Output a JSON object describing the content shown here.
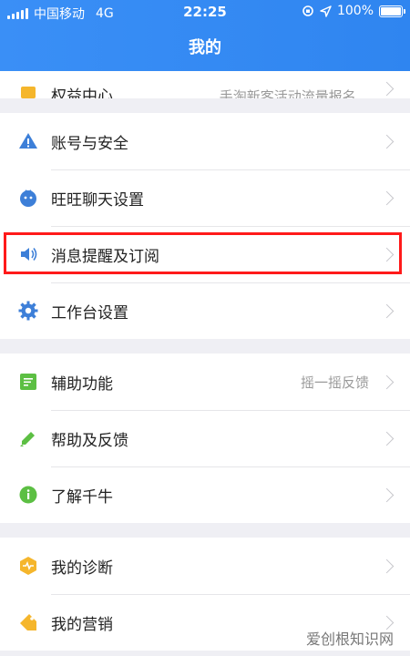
{
  "status_bar": {
    "carrier": "中国移动",
    "network": "4G",
    "time": "22:25",
    "battery_percent": "100%"
  },
  "header": {
    "title": "我的"
  },
  "groups": [
    {
      "items": [
        {
          "label": "权益中心",
          "value": "手淘新客活动流量报名...",
          "icon": "crown-icon",
          "icon_color": "#f5b62c"
        }
      ]
    },
    {
      "items": [
        {
          "label": "账号与安全",
          "value": "",
          "icon": "warning-icon",
          "icon_color": "#3d7fd8"
        },
        {
          "label": "旺旺聊天设置",
          "value": "",
          "icon": "wangwang-icon",
          "icon_color": "#3d7fd8"
        },
        {
          "label": "消息提醒及订阅",
          "value": "",
          "icon": "speaker-icon",
          "icon_color": "#3d7fd8"
        },
        {
          "label": "工作台设置",
          "value": "",
          "icon": "gear-icon",
          "icon_color": "#3d7fd8"
        }
      ]
    },
    {
      "items": [
        {
          "label": "辅助功能",
          "value": "摇一摇反馈",
          "icon": "document-icon",
          "icon_color": "#5cbf43"
        },
        {
          "label": "帮助及反馈",
          "value": "",
          "icon": "pencil-icon",
          "icon_color": "#5cbf43"
        },
        {
          "label": "了解千牛",
          "value": "",
          "icon": "info-icon",
          "icon_color": "#5cbf43"
        }
      ]
    },
    {
      "items": [
        {
          "label": "我的诊断",
          "value": "",
          "icon": "diagnosis-icon",
          "icon_color": "#f5b62c"
        },
        {
          "label": "我的营销",
          "value": "",
          "icon": "tag-icon",
          "icon_color": "#f5b62c"
        }
      ]
    }
  ],
  "watermark": "爱创根知识网"
}
